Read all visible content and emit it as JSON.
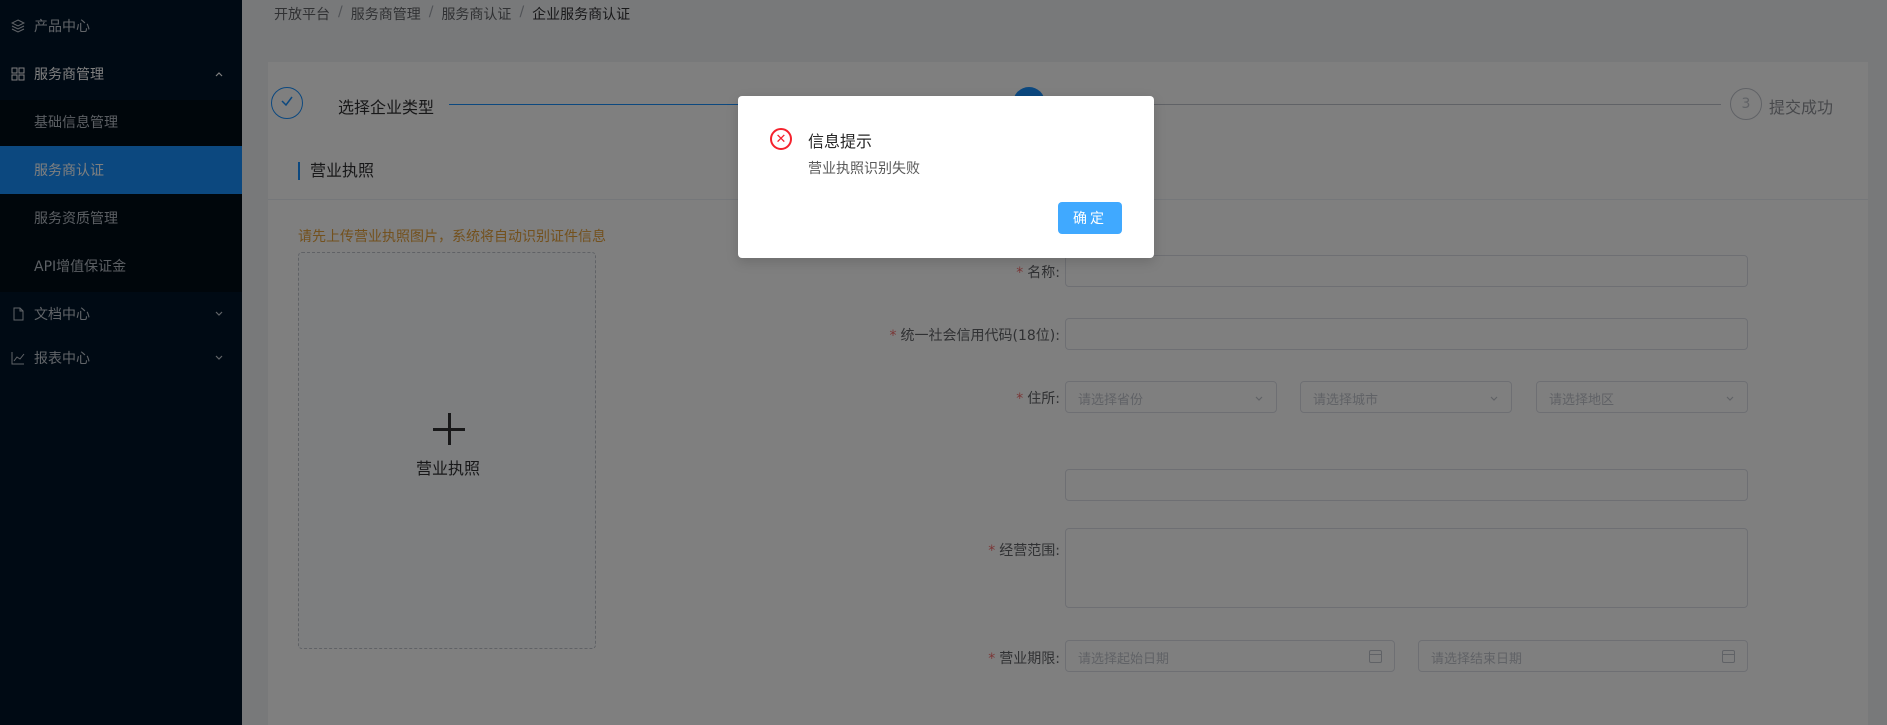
{
  "sidebar": {
    "items": [
      {
        "label": "产品中心",
        "icon": "layers-icon"
      },
      {
        "label": "服务商管理",
        "icon": "apps-icon"
      },
      {
        "label": "文档中心",
        "icon": "document-icon"
      },
      {
        "label": "报表中心",
        "icon": "chart-icon"
      }
    ],
    "sub_items": [
      {
        "label": "基础信息管理"
      },
      {
        "label": "服务商认证",
        "active": true
      },
      {
        "label": "服务资质管理"
      },
      {
        "label": "API增值保证金"
      }
    ]
  },
  "breadcrumb": {
    "items": [
      "开放平台",
      "服务商管理",
      "服务商认证",
      "企业服务商认证"
    ],
    "separator": "/"
  },
  "steps": {
    "step1_label": "选择企业类型",
    "step3_number": "3",
    "step3_label": "提交成功"
  },
  "section": {
    "title": "营业执照",
    "hint": "请先上传营业执照图片，系统将自动识别证件信息",
    "upload_label": "营业执照"
  },
  "form": {
    "name_label": "名称:",
    "credit_code_label": "统一社会信用代码(18位):",
    "address_label": "住所:",
    "province_placeholder": "请选择省份",
    "city_placeholder": "请选择城市",
    "district_placeholder": "请选择地区",
    "scope_label": "经营范围:",
    "period_label": "营业期限:",
    "start_date_placeholder": "请选择起始日期",
    "end_date_placeholder": "请选择结束日期",
    "required_mark": "*"
  },
  "dialog": {
    "title": "信息提示",
    "message": "营业执照识别失败",
    "confirm_label": "确定",
    "error_icon": "close-circle-icon"
  },
  "colors": {
    "sidebar_bg": "#001529",
    "primary": "#1890ff",
    "error": "#f5222d",
    "warning": "#e6a23c"
  }
}
